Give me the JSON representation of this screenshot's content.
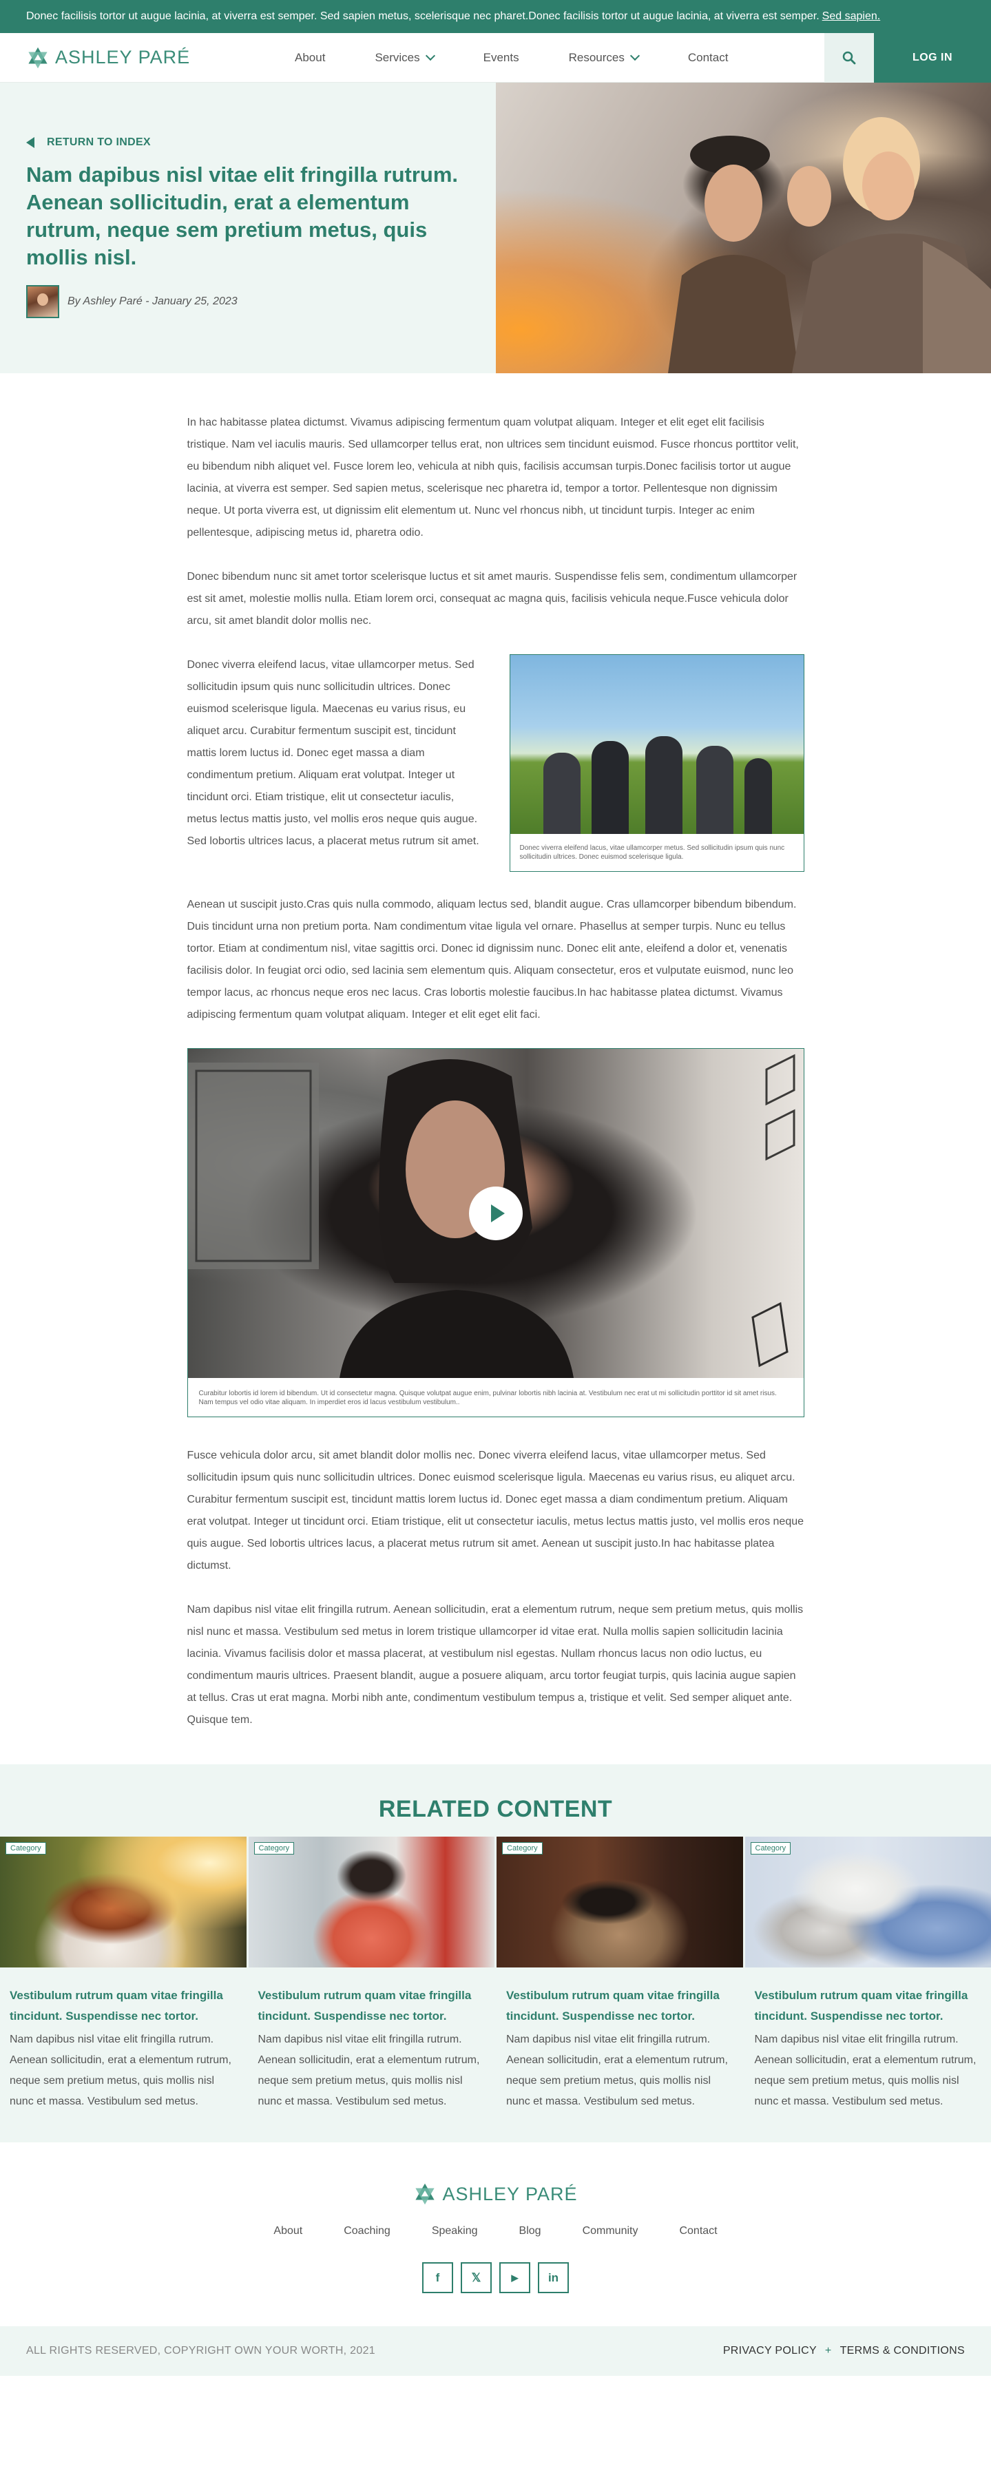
{
  "announcement": {
    "text": "Donec facilisis tortor ut augue lacinia, at viverra est semper. Sed sapien metus, scelerisque nec pharet.Donec facilisis tortor ut augue lacinia, at viverra est semper.",
    "link": "Sed sapien."
  },
  "brand": {
    "name": "ASHLEY PARÉ",
    "color": "#2e7f6c"
  },
  "nav": {
    "items": [
      {
        "label": "About",
        "dropdown": false
      },
      {
        "label": "Services",
        "dropdown": true
      },
      {
        "label": "Events",
        "dropdown": false
      },
      {
        "label": "Resources",
        "dropdown": true
      },
      {
        "label": "Contact",
        "dropdown": false
      }
    ],
    "search_icon": "search-icon",
    "login_label": "LOG IN"
  },
  "hero": {
    "back_label": "RETURN TO INDEX",
    "title": "Nam dapibus nisl vitae elit fringilla rutrum. Aenean sollicitudin, erat a elementum rutrum, neque sem pretium metus, quis mollis nisl.",
    "byline": "By Ashley Paré - January 25, 2023"
  },
  "article": {
    "p1": "In hac habitasse platea dictumst. Vivamus adipiscing fermentum quam volutpat aliquam. Integer et elit eget elit facilisis tristique. Nam vel iaculis mauris. Sed ullamcorper tellus erat, non ultrices sem tincidunt euismod. Fusce rhoncus porttitor velit, eu bibendum nibh aliquet vel. Fusce lorem leo, vehicula at nibh quis, facilisis accumsan turpis.Donec facilisis tortor ut augue lacinia, at viverra est semper. Sed sapien metus, scelerisque nec pharetra id, tempor a tortor. Pellentesque non dignissim neque. Ut porta viverra est, ut dignissim elit elementum ut. Nunc vel rhoncus nibh, ut tincidunt turpis. Integer ac enim pellentesque, adipiscing metus id, pharetra odio.",
    "p2": "Donec bibendum nunc sit amet tortor scelerisque luctus et sit amet mauris. Suspendisse felis sem, condimentum ullamcorper est sit amet, molestie mollis nulla. Etiam lorem orci, consequat ac magna quis, facilisis vehicula neque.Fusce vehicula dolor arcu, sit amet blandit dolor mollis nec.",
    "p3": "Donec viverra eleifend lacus, vitae ullamcorper metus. Sed sollicitudin ipsum quis nunc sollicitudin ultrices. Donec euismod scelerisque ligula. Maecenas eu varius risus, eu aliquet arcu. Curabitur fermentum suscipit est, tincidunt mattis lorem luctus id. Donec eget massa a diam condimentum pretium. Aliquam erat volutpat. Integer ut tincidunt orci. Etiam tristique, elit ut consectetur iaculis, metus lectus mattis justo, vel mollis eros neque quis augue. Sed lobortis ultrices lacus, a placerat metus rutrum sit amet.",
    "figure_caption": "Donec viverra eleifend lacus, vitae ullamcorper metus. Sed sollicitudin ipsum quis nunc sollicitudin ultrices. Donec euismod scelerisque ligula.",
    "p4": "Aenean ut suscipit justo.Cras quis nulla commodo, aliquam lectus sed, blandit augue. Cras ullamcorper bibendum bibendum. Duis tincidunt urna non pretium porta. Nam condimentum vitae ligula vel ornare. Phasellus at semper turpis. Nunc eu tellus tortor. Etiam at condimentum nisl, vitae sagittis orci. Donec id dignissim nunc. Donec elit ante, eleifend a dolor et, venenatis facilisis dolor. In feugiat orci odio, sed lacinia sem elementum quis. Aliquam consectetur, eros et vulputate euismod, nunc leo tempor lacus, ac rhoncus neque eros nec lacus. Cras lobortis molestie faucibus.In hac habitasse platea dictumst. Vivamus adipiscing fermentum quam volutpat aliquam. Integer et elit eget elit faci.",
    "video_caption": "Curabitur lobortis id lorem id bibendum. Ut id consectetur magna. Quisque volutpat augue enim, pulvinar lobortis nibh lacinia at. Vestibulum nec erat ut mi sollicitudin porttitor id sit amet risus. Nam tempus vel odio vitae aliquam. In imperdiet eros id lacus vestibulum vestibulum..",
    "p5": "Fusce vehicula dolor arcu, sit amet blandit dolor mollis nec. Donec viverra eleifend lacus, vitae ullamcorper metus. Sed sollicitudin ipsum quis nunc sollicitudin ultrices. Donec euismod scelerisque ligula. Maecenas eu varius risus, eu aliquet arcu. Curabitur fermentum suscipit est, tincidunt mattis lorem luctus id. Donec eget massa a diam condimentum pretium. Aliquam erat volutpat. Integer ut tincidunt orci. Etiam tristique, elit ut consectetur iaculis, metus lectus mattis justo, vel mollis eros neque quis augue. Sed lobortis ultrices lacus, a placerat metus rutrum sit amet. Aenean ut suscipit justo.In hac habitasse platea dictumst.",
    "p6": "Nam dapibus nisl vitae elit fringilla rutrum. Aenean sollicitudin, erat a elementum rutrum, neque sem pretium metus, quis mollis nisl nunc et massa. Vestibulum sed metus in lorem tristique ullamcorper id vitae erat. Nulla mollis sapien sollicitudin lacinia lacinia. Vivamus facilisis dolor et massa placerat, at vestibulum nisl egestas. Nullam rhoncus lacus non odio luctus, eu condimentum mauris ultrices. Praesent blandit, augue a posuere aliquam, arcu tortor feugiat turpis, quis lacinia augue sapien at tellus. Cras ut erat magna. Morbi nibh ante, condimentum vestibulum tempus a, tristique et velit. Sed semper aliquet ante. Quisque tem."
  },
  "related": {
    "heading": "RELATED CONTENT",
    "cards": [
      {
        "badge": "Category",
        "title": "Vestibulum rutrum quam vitae fringilla tincidunt. Suspendisse nec tortor.",
        "text": "Nam dapibus nisl vitae elit fringilla rutrum. Aenean sollicitudin, erat a elementum rutrum, neque sem pretium metus, quis mollis nisl nunc et massa. Vestibulum sed metus."
      },
      {
        "badge": "Category",
        "title": "Vestibulum rutrum quam vitae fringilla tincidunt. Suspendisse nec tortor.",
        "text": "Nam dapibus nisl vitae elit fringilla rutrum. Aenean sollicitudin, erat a elementum rutrum, neque sem pretium metus, quis mollis nisl nunc et massa. Vestibulum sed metus."
      },
      {
        "badge": "Category",
        "title": "Vestibulum rutrum quam vitae fringilla tincidunt. Suspendisse nec tortor.",
        "text": "Nam dapibus nisl vitae elit fringilla rutrum. Aenean sollicitudin, erat a elementum rutrum, neque sem pretium metus, quis mollis nisl nunc et massa. Vestibulum sed metus."
      },
      {
        "badge": "Category",
        "title": "Vestibulum rutrum quam vitae fringilla tincidunt. Suspendisse nec tortor.",
        "text": "Nam dapibus nisl vitae elit fringilla rutrum. Aenean sollicitudin, erat a elementum rutrum, neque sem pretium metus, quis mollis nisl nunc et massa. Vestibulum sed metus."
      }
    ]
  },
  "footer": {
    "nav": [
      "About",
      "Coaching",
      "Speaking",
      "Blog",
      "Community",
      "Contact"
    ],
    "socials": [
      {
        "icon": "facebook-icon",
        "glyph": "f"
      },
      {
        "icon": "x-icon",
        "glyph": "𝕏"
      },
      {
        "icon": "youtube-icon",
        "glyph": "▶"
      },
      {
        "icon": "linkedin-icon",
        "glyph": "in"
      }
    ],
    "copyright": "ALL RIGHTS RESERVED, COPYRIGHT OWN YOUR WORTH, 2021",
    "privacy": "PRIVACY POLICY",
    "separator": "+",
    "terms": "TERMS & CONDITIONS"
  }
}
